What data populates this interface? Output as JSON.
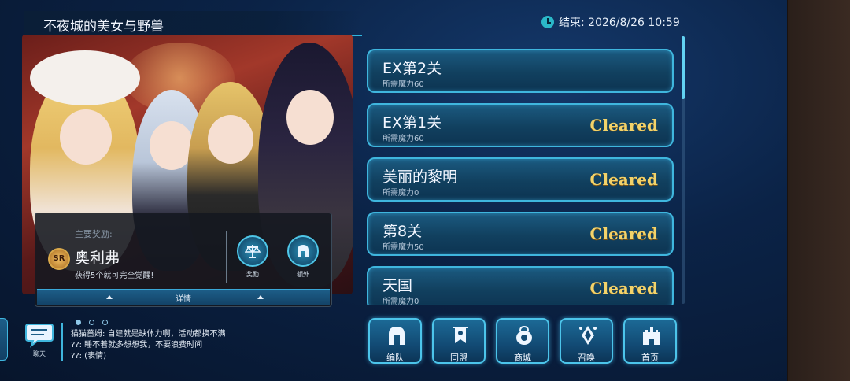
{
  "event": {
    "title": "不夜城的美女与野兽",
    "end_time": "结束: 2026/8/26 10:59"
  },
  "reward": {
    "label": "主要奖励:",
    "badge": "SR",
    "name": "奥利弗",
    "desc": "获得5个就可完全觉醒!",
    "buttons": [
      {
        "label": "奖励",
        "icon": "scales-icon"
      },
      {
        "label": "额外",
        "icon": "helmet-icon"
      }
    ],
    "detail_label": "详情"
  },
  "stages": [
    {
      "name": "EX第2关",
      "requirement": "所需魔力60",
      "status": ""
    },
    {
      "name": "EX第1关",
      "requirement": "所需魔力60",
      "status": "Cleared"
    },
    {
      "name": "美丽的黎明",
      "requirement": "所需魔力0",
      "status": "Cleared"
    },
    {
      "name": "第8关",
      "requirement": "所需魔力50",
      "status": "Cleared"
    },
    {
      "name": "天国",
      "requirement": "所需魔力0",
      "status": "Cleared"
    }
  ],
  "chat": {
    "button_label": "聊天",
    "page_indicator": {
      "total": 3,
      "active": 0
    },
    "lines": [
      "猫猫蔷姆: 自建就是缺体力啊，活动都换不满",
      "??: 睡不着就多想想我，不要浪费时间",
      "??: (表情)"
    ]
  },
  "nav": [
    {
      "label": "编队",
      "icon": "helmet-icon"
    },
    {
      "label": "同盟",
      "icon": "banner-icon"
    },
    {
      "label": "商城",
      "icon": "shop-bag-icon"
    },
    {
      "label": "召唤",
      "icon": "summon-crystal-icon"
    },
    {
      "label": "首页",
      "icon": "castle-icon"
    }
  ],
  "colors": {
    "accent": "#3fb6de",
    "cleared": "#f3d36a",
    "panel": "#11405f"
  }
}
